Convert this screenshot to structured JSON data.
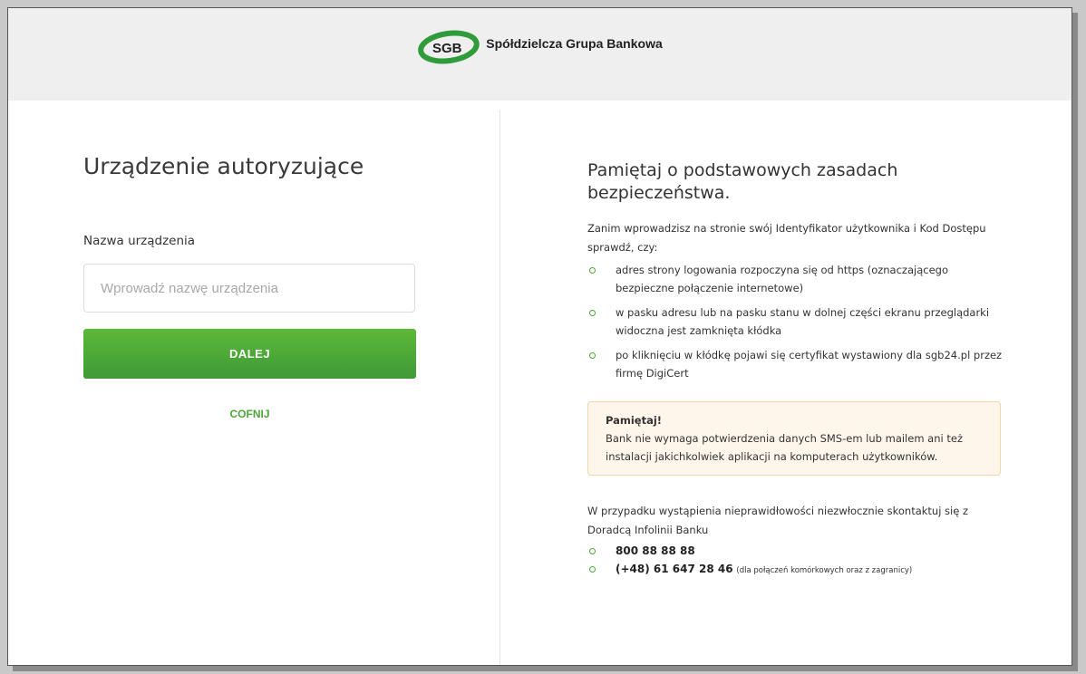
{
  "header": {
    "logo_text": "SGB",
    "brand_name": "Spółdzielcza Grupa Bankowa"
  },
  "form": {
    "title": "Urządzenie autoryzujące",
    "device_label": "Nazwa urządzenia",
    "device_placeholder": "Wprowadź nazwę urządzenia",
    "device_value": "",
    "submit_label": "DALEJ",
    "back_label": "COFNIJ"
  },
  "security": {
    "title": "Pamiętaj o podstawowych zasadach bezpieczeństwa.",
    "intro": "Zanim wprowadzisz na stronie swój Identyfikator użytkownika i Kod Dostępu sprawdź, czy:",
    "bullets": [
      "adres strony logowania rozpoczyna się od https (oznaczającego bezpieczne połączenie internetowe)",
      "w pasku adresu lub na pasku stanu w dolnej części ekranu przeglądarki widoczna jest zamknięta kłódka",
      "po kliknięciu w kłódkę pojawi się certyfikat wystawiony dla sgb24.pl przez firmę DigiCert"
    ],
    "notice_title": "Pamiętaj!",
    "notice_text": "Bank nie wymaga potwierdzenia danych SMS-em lub mailem ani też instalacji jakichkolwiek aplikacji na komputerach użytkowników.",
    "contact_text": "W przypadku wystąpienia nieprawidłowości niezwłocznie skontaktuj się z Doradcą Infolinii Banku",
    "phones": [
      {
        "number": "800 88 88 88",
        "note": ""
      },
      {
        "number": "(+48) 61 647 28 46",
        "note": "(dla połączeń komórkowych oraz z zagranicy)"
      }
    ]
  },
  "colors": {
    "accent_green": "#4aa836",
    "button_green": "#4fab37",
    "header_bg": "#efefef",
    "notice_bg": "#fef6eb",
    "notice_border": "#f2d5a8"
  }
}
